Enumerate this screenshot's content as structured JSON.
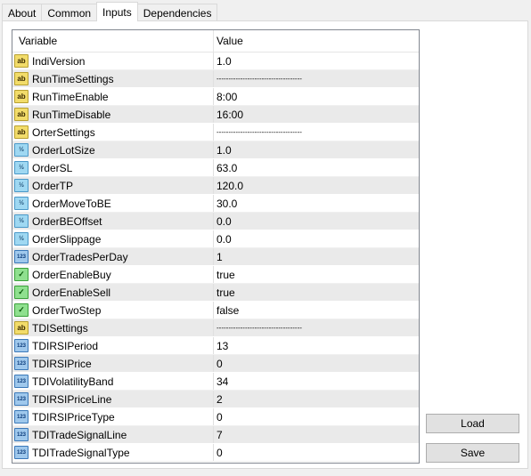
{
  "tabs": [
    {
      "label": "About",
      "active": false
    },
    {
      "label": "Common",
      "active": false
    },
    {
      "label": "Inputs",
      "active": true
    },
    {
      "label": "Dependencies",
      "active": false
    }
  ],
  "table": {
    "columns": [
      "Variable",
      "Value"
    ],
    "rows": [
      {
        "type": "string",
        "icon": "string-icon",
        "name": "IndiVersion",
        "value": "1.0"
      },
      {
        "type": "string",
        "icon": "string-icon",
        "name": "RunTimeSettings",
        "value": "------------------------------------"
      },
      {
        "type": "string",
        "icon": "string-icon",
        "name": "RunTimeEnable",
        "value": "8:00"
      },
      {
        "type": "string",
        "icon": "string-icon",
        "name": "RunTimeDisable",
        "value": "16:00"
      },
      {
        "type": "string",
        "icon": "string-icon",
        "name": "OrterSettings",
        "value": "------------------------------------"
      },
      {
        "type": "double",
        "icon": "double-icon",
        "name": "OrderLotSize",
        "value": "1.0"
      },
      {
        "type": "double",
        "icon": "double-icon",
        "name": "OrderSL",
        "value": "63.0"
      },
      {
        "type": "double",
        "icon": "double-icon",
        "name": "OrderTP",
        "value": "120.0"
      },
      {
        "type": "double",
        "icon": "double-icon",
        "name": "OrderMoveToBE",
        "value": "30.0"
      },
      {
        "type": "double",
        "icon": "double-icon",
        "name": "OrderBEOffset",
        "value": "0.0"
      },
      {
        "type": "double",
        "icon": "double-icon",
        "name": "OrderSlippage",
        "value": "0.0"
      },
      {
        "type": "int",
        "icon": "integer-icon",
        "name": "OrderTradesPerDay",
        "value": "1"
      },
      {
        "type": "bool",
        "icon": "boolean-icon",
        "name": "OrderEnableBuy",
        "value": "true"
      },
      {
        "type": "bool",
        "icon": "boolean-icon",
        "name": "OrderEnableSell",
        "value": "true"
      },
      {
        "type": "bool",
        "icon": "boolean-icon",
        "name": "OrderTwoStep",
        "value": "false"
      },
      {
        "type": "string",
        "icon": "string-icon",
        "name": "TDISettings",
        "value": "------------------------------------"
      },
      {
        "type": "int",
        "icon": "integer-icon",
        "name": "TDIRSIPeriod",
        "value": "13"
      },
      {
        "type": "int",
        "icon": "integer-icon",
        "name": "TDIRSIPrice",
        "value": "0"
      },
      {
        "type": "int",
        "icon": "integer-icon",
        "name": "TDIVolatilityBand",
        "value": "34"
      },
      {
        "type": "int",
        "icon": "integer-icon",
        "name": "TDIRSIPriceLine",
        "value": "2"
      },
      {
        "type": "int",
        "icon": "integer-icon",
        "name": "TDIRSIPriceType",
        "value": "0"
      },
      {
        "type": "int",
        "icon": "integer-icon",
        "name": "TDITradeSignalLine",
        "value": "7"
      },
      {
        "type": "int",
        "icon": "integer-icon",
        "name": "TDITradeSignalType",
        "value": "0"
      }
    ]
  },
  "icon_glyphs": {
    "string": "ab",
    "double": "½",
    "int": "123",
    "bool": "✓"
  },
  "buttons": {
    "load_label": "Load",
    "save_label": "Save"
  }
}
